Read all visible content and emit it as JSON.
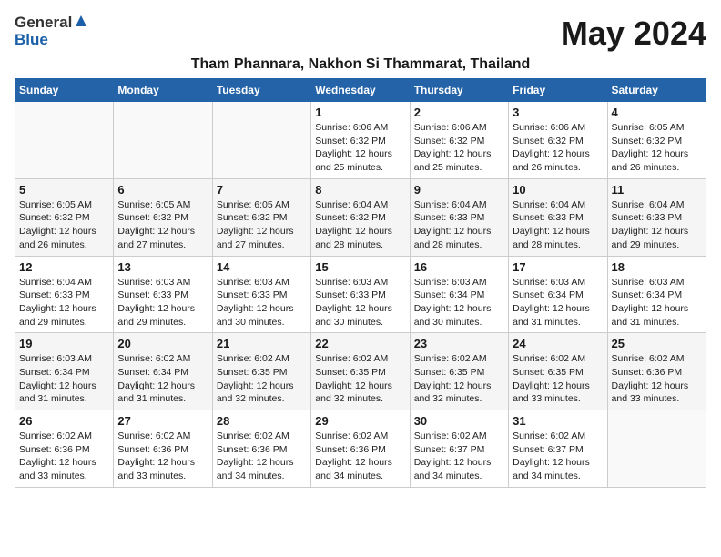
{
  "header": {
    "logo_general": "General",
    "logo_blue": "Blue",
    "month_title": "May 2024",
    "subtitle": "Tham Phannara, Nakhon Si Thammarat, Thailand"
  },
  "days_of_week": [
    "Sunday",
    "Monday",
    "Tuesday",
    "Wednesday",
    "Thursday",
    "Friday",
    "Saturday"
  ],
  "weeks": [
    [
      {
        "day": "",
        "info": ""
      },
      {
        "day": "",
        "info": ""
      },
      {
        "day": "",
        "info": ""
      },
      {
        "day": "1",
        "info": "Sunrise: 6:06 AM\nSunset: 6:32 PM\nDaylight: 12 hours\nand 25 minutes."
      },
      {
        "day": "2",
        "info": "Sunrise: 6:06 AM\nSunset: 6:32 PM\nDaylight: 12 hours\nand 25 minutes."
      },
      {
        "day": "3",
        "info": "Sunrise: 6:06 AM\nSunset: 6:32 PM\nDaylight: 12 hours\nand 26 minutes."
      },
      {
        "day": "4",
        "info": "Sunrise: 6:05 AM\nSunset: 6:32 PM\nDaylight: 12 hours\nand 26 minutes."
      }
    ],
    [
      {
        "day": "5",
        "info": "Sunrise: 6:05 AM\nSunset: 6:32 PM\nDaylight: 12 hours\nand 26 minutes."
      },
      {
        "day": "6",
        "info": "Sunrise: 6:05 AM\nSunset: 6:32 PM\nDaylight: 12 hours\nand 27 minutes."
      },
      {
        "day": "7",
        "info": "Sunrise: 6:05 AM\nSunset: 6:32 PM\nDaylight: 12 hours\nand 27 minutes."
      },
      {
        "day": "8",
        "info": "Sunrise: 6:04 AM\nSunset: 6:32 PM\nDaylight: 12 hours\nand 28 minutes."
      },
      {
        "day": "9",
        "info": "Sunrise: 6:04 AM\nSunset: 6:33 PM\nDaylight: 12 hours\nand 28 minutes."
      },
      {
        "day": "10",
        "info": "Sunrise: 6:04 AM\nSunset: 6:33 PM\nDaylight: 12 hours\nand 28 minutes."
      },
      {
        "day": "11",
        "info": "Sunrise: 6:04 AM\nSunset: 6:33 PM\nDaylight: 12 hours\nand 29 minutes."
      }
    ],
    [
      {
        "day": "12",
        "info": "Sunrise: 6:04 AM\nSunset: 6:33 PM\nDaylight: 12 hours\nand 29 minutes."
      },
      {
        "day": "13",
        "info": "Sunrise: 6:03 AM\nSunset: 6:33 PM\nDaylight: 12 hours\nand 29 minutes."
      },
      {
        "day": "14",
        "info": "Sunrise: 6:03 AM\nSunset: 6:33 PM\nDaylight: 12 hours\nand 30 minutes."
      },
      {
        "day": "15",
        "info": "Sunrise: 6:03 AM\nSunset: 6:33 PM\nDaylight: 12 hours\nand 30 minutes."
      },
      {
        "day": "16",
        "info": "Sunrise: 6:03 AM\nSunset: 6:34 PM\nDaylight: 12 hours\nand 30 minutes."
      },
      {
        "day": "17",
        "info": "Sunrise: 6:03 AM\nSunset: 6:34 PM\nDaylight: 12 hours\nand 31 minutes."
      },
      {
        "day": "18",
        "info": "Sunrise: 6:03 AM\nSunset: 6:34 PM\nDaylight: 12 hours\nand 31 minutes."
      }
    ],
    [
      {
        "day": "19",
        "info": "Sunrise: 6:03 AM\nSunset: 6:34 PM\nDaylight: 12 hours\nand 31 minutes."
      },
      {
        "day": "20",
        "info": "Sunrise: 6:02 AM\nSunset: 6:34 PM\nDaylight: 12 hours\nand 31 minutes."
      },
      {
        "day": "21",
        "info": "Sunrise: 6:02 AM\nSunset: 6:35 PM\nDaylight: 12 hours\nand 32 minutes."
      },
      {
        "day": "22",
        "info": "Sunrise: 6:02 AM\nSunset: 6:35 PM\nDaylight: 12 hours\nand 32 minutes."
      },
      {
        "day": "23",
        "info": "Sunrise: 6:02 AM\nSunset: 6:35 PM\nDaylight: 12 hours\nand 32 minutes."
      },
      {
        "day": "24",
        "info": "Sunrise: 6:02 AM\nSunset: 6:35 PM\nDaylight: 12 hours\nand 33 minutes."
      },
      {
        "day": "25",
        "info": "Sunrise: 6:02 AM\nSunset: 6:36 PM\nDaylight: 12 hours\nand 33 minutes."
      }
    ],
    [
      {
        "day": "26",
        "info": "Sunrise: 6:02 AM\nSunset: 6:36 PM\nDaylight: 12 hours\nand 33 minutes."
      },
      {
        "day": "27",
        "info": "Sunrise: 6:02 AM\nSunset: 6:36 PM\nDaylight: 12 hours\nand 33 minutes."
      },
      {
        "day": "28",
        "info": "Sunrise: 6:02 AM\nSunset: 6:36 PM\nDaylight: 12 hours\nand 34 minutes."
      },
      {
        "day": "29",
        "info": "Sunrise: 6:02 AM\nSunset: 6:36 PM\nDaylight: 12 hours\nand 34 minutes."
      },
      {
        "day": "30",
        "info": "Sunrise: 6:02 AM\nSunset: 6:37 PM\nDaylight: 12 hours\nand 34 minutes."
      },
      {
        "day": "31",
        "info": "Sunrise: 6:02 AM\nSunset: 6:37 PM\nDaylight: 12 hours\nand 34 minutes."
      },
      {
        "day": "",
        "info": ""
      }
    ]
  ]
}
